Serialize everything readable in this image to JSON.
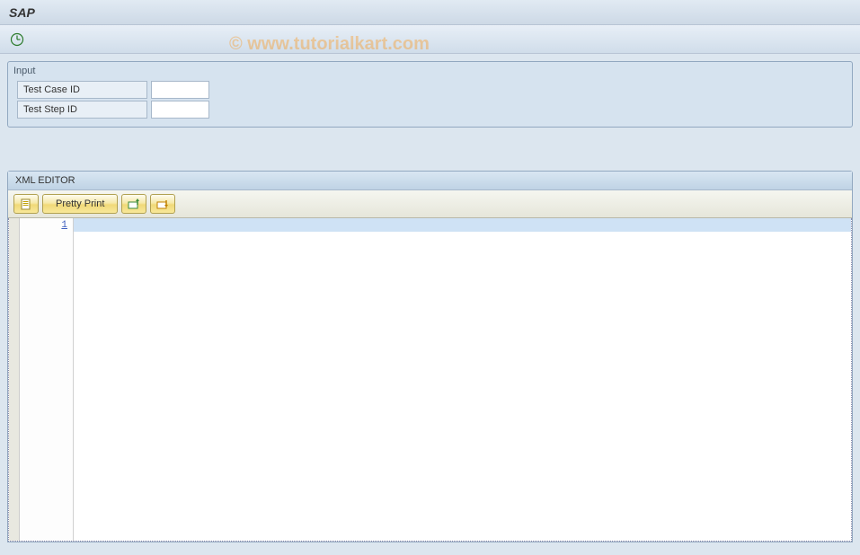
{
  "header": {
    "title": "SAP"
  },
  "watermark": "© www.tutorialkart.com",
  "input_group": {
    "title": "Input",
    "fields": {
      "test_case_id": {
        "label": "Test Case ID",
        "value": ""
      },
      "test_step_id": {
        "label": "Test Step ID",
        "value": ""
      }
    }
  },
  "xml_editor": {
    "title": "XML EDITOR",
    "toolbar": {
      "pretty_print": "Pretty Print"
    },
    "line_numbers": [
      "1"
    ],
    "content": ""
  }
}
